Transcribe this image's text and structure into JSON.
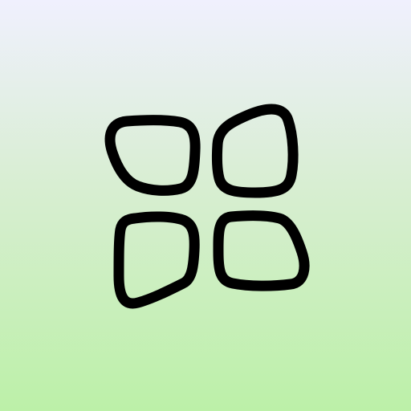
{
  "app_icon": {
    "icon_name": "four-rounded-squares-grid-icon",
    "background_top_color": "#f0f0fe",
    "background_bottom_color": "#bcf0a8",
    "stroke_color": "#000000"
  }
}
